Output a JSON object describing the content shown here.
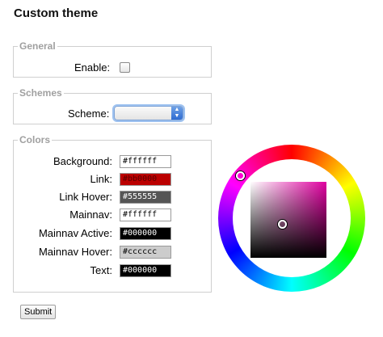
{
  "page": {
    "title": "Custom theme"
  },
  "general": {
    "legend": "General",
    "enable_label": "Enable:",
    "enable_checked": false
  },
  "schemes": {
    "legend": "Schemes",
    "scheme_label": "Scheme:",
    "scheme_value": ""
  },
  "colors": {
    "legend": "Colors",
    "fields": [
      {
        "label": "Background:",
        "value": "#ffffff",
        "bg": "#ffffff",
        "fg": "#000000"
      },
      {
        "label": "Link:",
        "value": "#bb0000",
        "bg": "#bb0000",
        "fg": "#5a0000"
      },
      {
        "label": "Link Hover:",
        "value": "#555555",
        "bg": "#555555",
        "fg": "#ffffff"
      },
      {
        "label": "Mainnav:",
        "value": "#ffffff",
        "bg": "#ffffff",
        "fg": "#000000"
      },
      {
        "label": "Mainnav Active:",
        "value": "#000000",
        "bg": "#000000",
        "fg": "#ffffff"
      },
      {
        "label": "Mainnav Hover:",
        "value": "#cccccc",
        "bg": "#cccccc",
        "fg": "#000000"
      },
      {
        "label": "Text:",
        "value": "#000000",
        "bg": "#000000",
        "fg": "#ffffff"
      }
    ]
  },
  "color_picker": {
    "hue_color": "#ff00cc"
  },
  "submit": {
    "label": "Submit"
  }
}
